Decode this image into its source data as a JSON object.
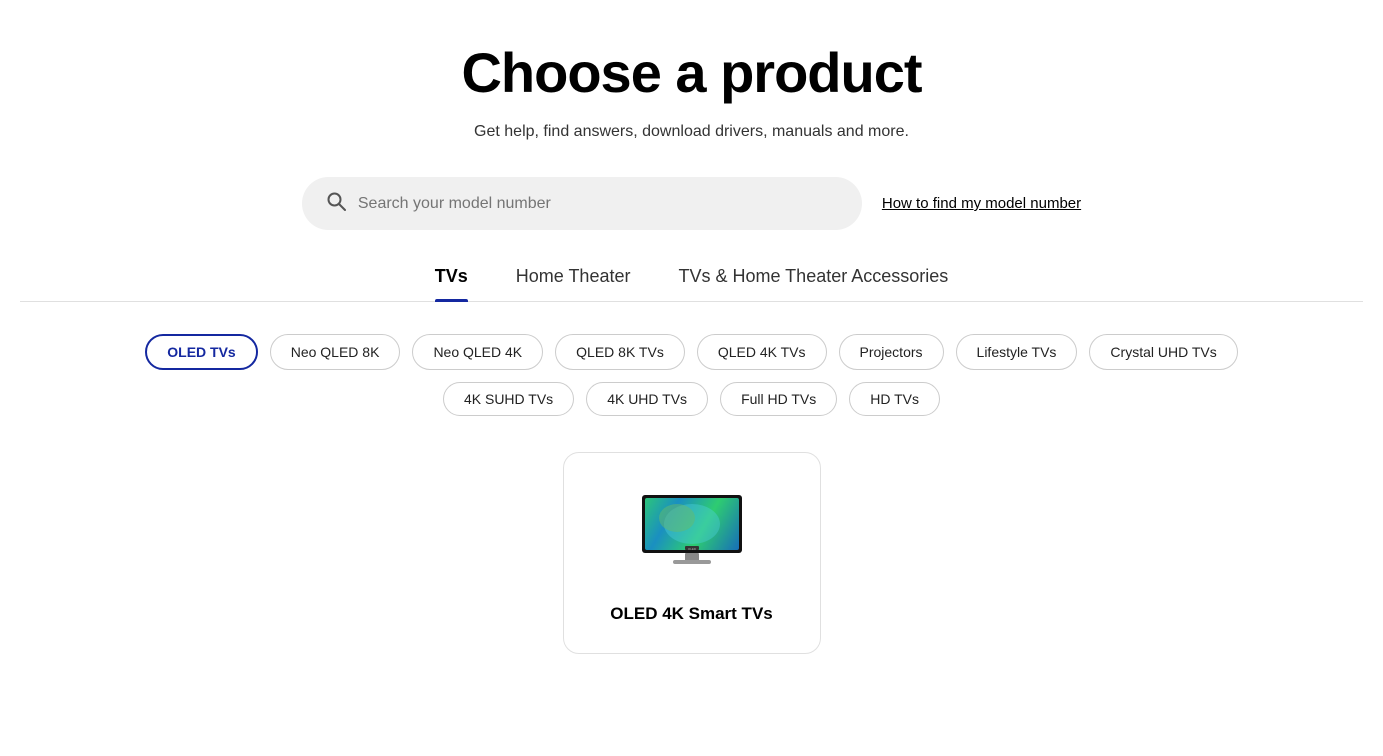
{
  "page": {
    "title": "Choose a product",
    "subtitle": "Get help, find answers, download drivers, manuals and more.",
    "search_placeholder": "Search your model number",
    "model_help_link": "How to find my model number"
  },
  "tabs": [
    {
      "id": "tvs",
      "label": "TVs",
      "active": true
    },
    {
      "id": "home-theater",
      "label": "Home Theater",
      "active": false
    },
    {
      "id": "accessories",
      "label": "TVs & Home Theater Accessories",
      "active": false
    }
  ],
  "filters_row1": [
    {
      "id": "oled-tvs",
      "label": "OLED TVs",
      "active": true
    },
    {
      "id": "neo-qled-8k",
      "label": "Neo QLED 8K",
      "active": false
    },
    {
      "id": "neo-qled-4k",
      "label": "Neo QLED 4K",
      "active": false
    },
    {
      "id": "qled-8k-tvs",
      "label": "QLED 8K TVs",
      "active": false
    },
    {
      "id": "qled-4k-tvs",
      "label": "QLED 4K TVs",
      "active": false
    },
    {
      "id": "projectors",
      "label": "Projectors",
      "active": false
    },
    {
      "id": "lifestyle-tvs",
      "label": "Lifestyle TVs",
      "active": false
    },
    {
      "id": "crystal-uhd-tvs",
      "label": "Crystal UHD TVs",
      "active": false
    }
  ],
  "filters_row2": [
    {
      "id": "4k-suhd-tvs",
      "label": "4K SUHD TVs",
      "active": false
    },
    {
      "id": "4k-uhd-tvs",
      "label": "4K UHD TVs",
      "active": false
    },
    {
      "id": "full-hd-tvs",
      "label": "Full HD TVs",
      "active": false
    },
    {
      "id": "hd-tvs",
      "label": "HD TVs",
      "active": false
    }
  ],
  "products": [
    {
      "id": "oled-4k-smart",
      "title": "OLED 4K Smart TVs"
    }
  ],
  "colors": {
    "accent": "#1428a0"
  }
}
